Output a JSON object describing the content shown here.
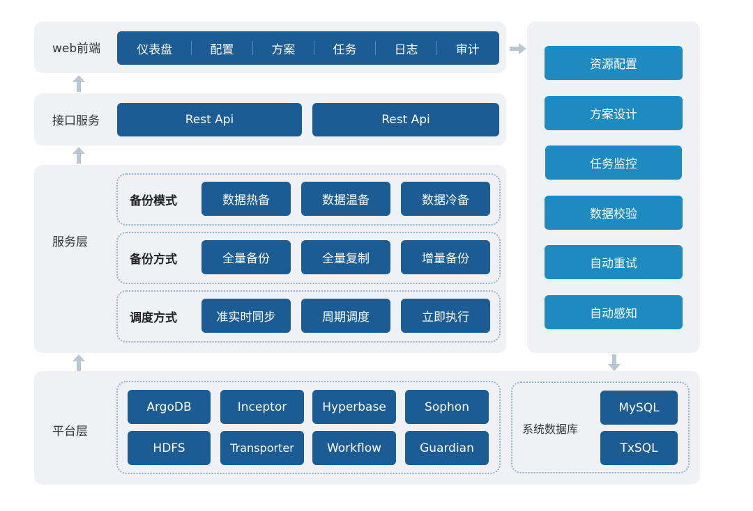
{
  "web_frontend": {
    "label": "web前端",
    "items": [
      "仪表盘",
      "配置",
      "方案",
      "任务",
      "日志",
      "审计"
    ]
  },
  "interface_service": {
    "label": "接口服务",
    "items": [
      "Rest Api",
      "Rest Api"
    ]
  },
  "service_layer": {
    "label": "服务层",
    "groups": [
      {
        "label": "备份模式",
        "items": [
          "数据热备",
          "数据温备",
          "数据冷备"
        ]
      },
      {
        "label": "备份方式",
        "items": [
          "全量备份",
          "全量复制",
          "增量备份"
        ]
      },
      {
        "label": "调度方式",
        "items": [
          "准实时同步",
          "周期调度",
          "立即执行"
        ]
      }
    ]
  },
  "platform_layer": {
    "label": "平台层",
    "components": [
      "ArgoDB",
      "Inceptor",
      "Hyperbase",
      "Sophon",
      "HDFS",
      "Transporter",
      "Workflow",
      "Guardian"
    ],
    "system_db": {
      "label": "系统数据库",
      "items": [
        "MySQL",
        "TxSQL"
      ]
    }
  },
  "right_panel": {
    "items": [
      "资源配置",
      "方案设计",
      "任务监控",
      "数据校验",
      "自动重试",
      "自动感知"
    ]
  },
  "colors": {
    "primary_blue": "#1b5c94",
    "light_blue": "#1d8bc0",
    "panel_bg": "#eff1f5",
    "arrow": "#b9c6d3"
  }
}
